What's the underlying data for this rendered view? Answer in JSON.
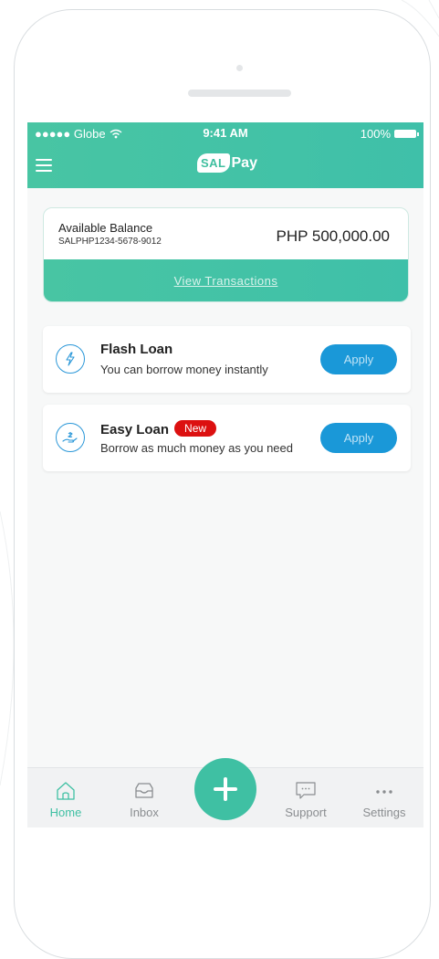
{
  "status_bar": {
    "carrier": "●●●●● Globe",
    "time": "9:41 AM",
    "battery": "100%"
  },
  "app": {
    "logo_sal": "SAL",
    "logo_pay": "Pay"
  },
  "balance": {
    "label": "Available Balance",
    "account": "SALPHP1234-5678-9012",
    "amount": "PHP 500,000.00",
    "link": "View Transactions"
  },
  "loans": [
    {
      "title": "Flash Loan",
      "description": "You can borrow money instantly",
      "button": "Apply",
      "icon": "lightning-icon"
    },
    {
      "title": "Easy Loan",
      "badge": "New",
      "description": "Borrow as much money as you need",
      "button": "Apply",
      "icon": "hand-money-icon"
    }
  ],
  "tabbar": {
    "items": [
      {
        "label": "Home",
        "icon": "home-icon",
        "active": true
      },
      {
        "label": "Inbox",
        "icon": "inbox-icon",
        "active": false
      },
      {
        "label": "Support",
        "icon": "chat-bubble-icon",
        "active": false
      },
      {
        "label": "Settings",
        "icon": "more-dots-icon",
        "active": false
      }
    ],
    "fab_icon": "plus-icon"
  },
  "colors": {
    "accent": "#3fc0a3",
    "button_blue": "#1a98d8",
    "badge_red": "#dc1010"
  }
}
